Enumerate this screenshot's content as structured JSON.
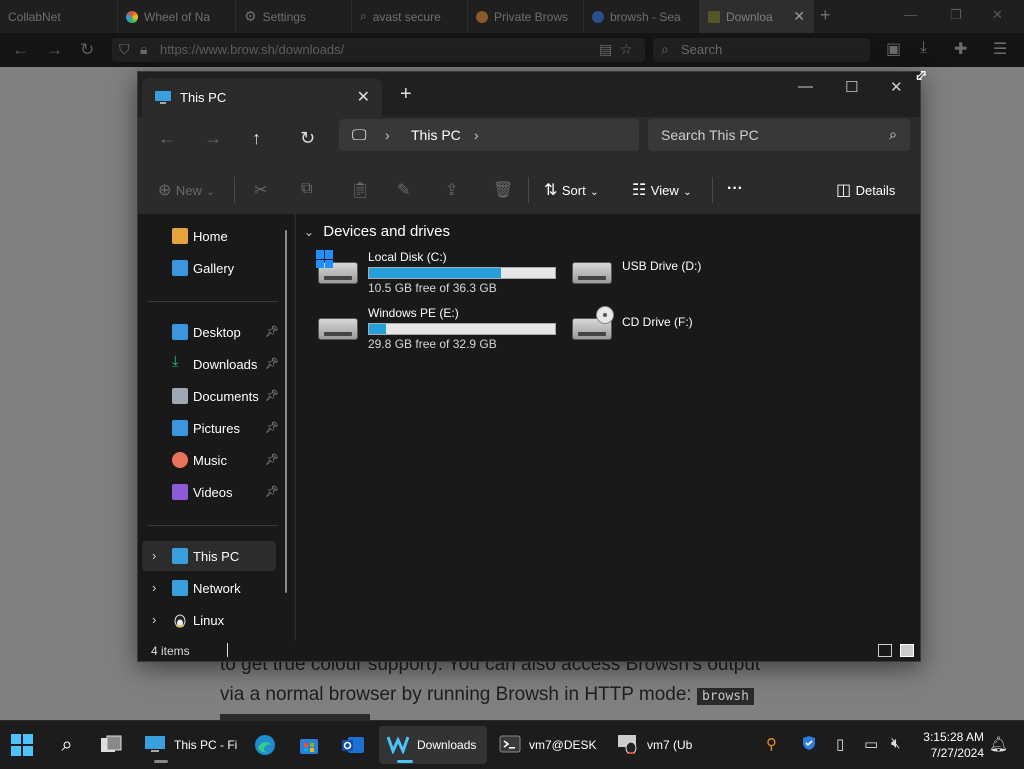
{
  "browser": {
    "tabs": [
      {
        "label": "CollabNet",
        "fav": ""
      },
      {
        "label": "Wheel of Na",
        "fav": "#e34c26"
      },
      {
        "label": "Settings",
        "fav": ""
      },
      {
        "label": "avast secure",
        "fav": "#555"
      },
      {
        "label": "Private Brows",
        "fav": "#b8692b"
      },
      {
        "label": "browsh - Sea",
        "fav": "#2a5aa8"
      },
      {
        "label": "Downloa",
        "fav": "#6b6b2b"
      }
    ],
    "url": "https://www.brow.sh/downloads/",
    "search_placeholder": "Search"
  },
  "page": {
    "line1": "to get true colour support). You can also access Browsh's output",
    "line2": "via a normal browser by running Browsh in HTTP mode:",
    "code": "browsh"
  },
  "explorer": {
    "tab_title": "This PC",
    "breadcrumb": "This PC",
    "search_placeholder": "Search This PC",
    "commands": {
      "new": "New",
      "sort": "Sort",
      "view": "View",
      "details": "Details"
    },
    "sidebar": {
      "quick": [
        {
          "label": "Home",
          "color": "#e8a33d"
        },
        {
          "label": "Gallery",
          "color": "#3a96dd"
        }
      ],
      "pinned": [
        {
          "label": "Desktop",
          "color": "#3a96dd"
        },
        {
          "label": "Downloads",
          "color": "#2fb46e"
        },
        {
          "label": "Documents",
          "color": "#9ea7b3"
        },
        {
          "label": "Pictures",
          "color": "#3a96dd"
        },
        {
          "label": "Music",
          "color": "#e8735a"
        },
        {
          "label": "Videos",
          "color": "#8e5bd6"
        }
      ],
      "tree": [
        {
          "label": "This PC",
          "color": "#3aa0dd"
        },
        {
          "label": "Network",
          "color": "#3aa0dd"
        },
        {
          "label": "Linux",
          "color": "#f0c419"
        }
      ]
    },
    "group_header": "Devices and drives",
    "drives": [
      {
        "name": "Local Disk (C:)",
        "free_text": "10.5 GB free of 36.3 GB",
        "used_fraction": 0.71
      },
      {
        "name": "USB Drive (D:)"
      },
      {
        "name": "Windows PE (E:)",
        "free_text": "29.8 GB free of 32.9 GB",
        "used_fraction": 0.09
      },
      {
        "name": "CD Drive (F:)"
      }
    ],
    "status": "4 items"
  },
  "taskbar": {
    "apps": [
      {
        "label": "This PC - Fi"
      },
      {
        "label": "Downloads"
      },
      {
        "label": "vm7@DESK"
      },
      {
        "label": "vm7 (Ub"
      }
    ],
    "time": "3:15:28 AM",
    "date": "7/27/2024"
  },
  "colors": {
    "accent": "#26a0da",
    "taskbar_active_indicator": "#4cc2ff"
  }
}
